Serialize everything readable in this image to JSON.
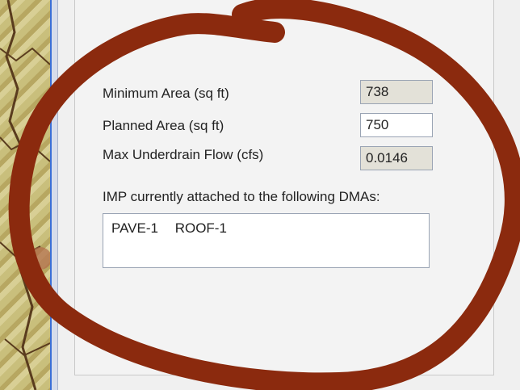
{
  "form": {
    "min_area_label": "Minimum Area (sq ft)",
    "min_area_value": "738",
    "planned_area_label": "Planned Area (sq ft)",
    "planned_area_value": "750",
    "max_flow_label": "Max Underdrain Flow (cfs)",
    "max_flow_value": "0.0146",
    "dma_list_label": "IMP currently attached to the following DMAs:",
    "dma_items": [
      "PAVE-1",
      "ROOF-1"
    ]
  },
  "colors": {
    "annotation_loop": "#8b2a0e",
    "panel_background": "#f0f0f0",
    "readonly_field": "#e3e1d8"
  }
}
